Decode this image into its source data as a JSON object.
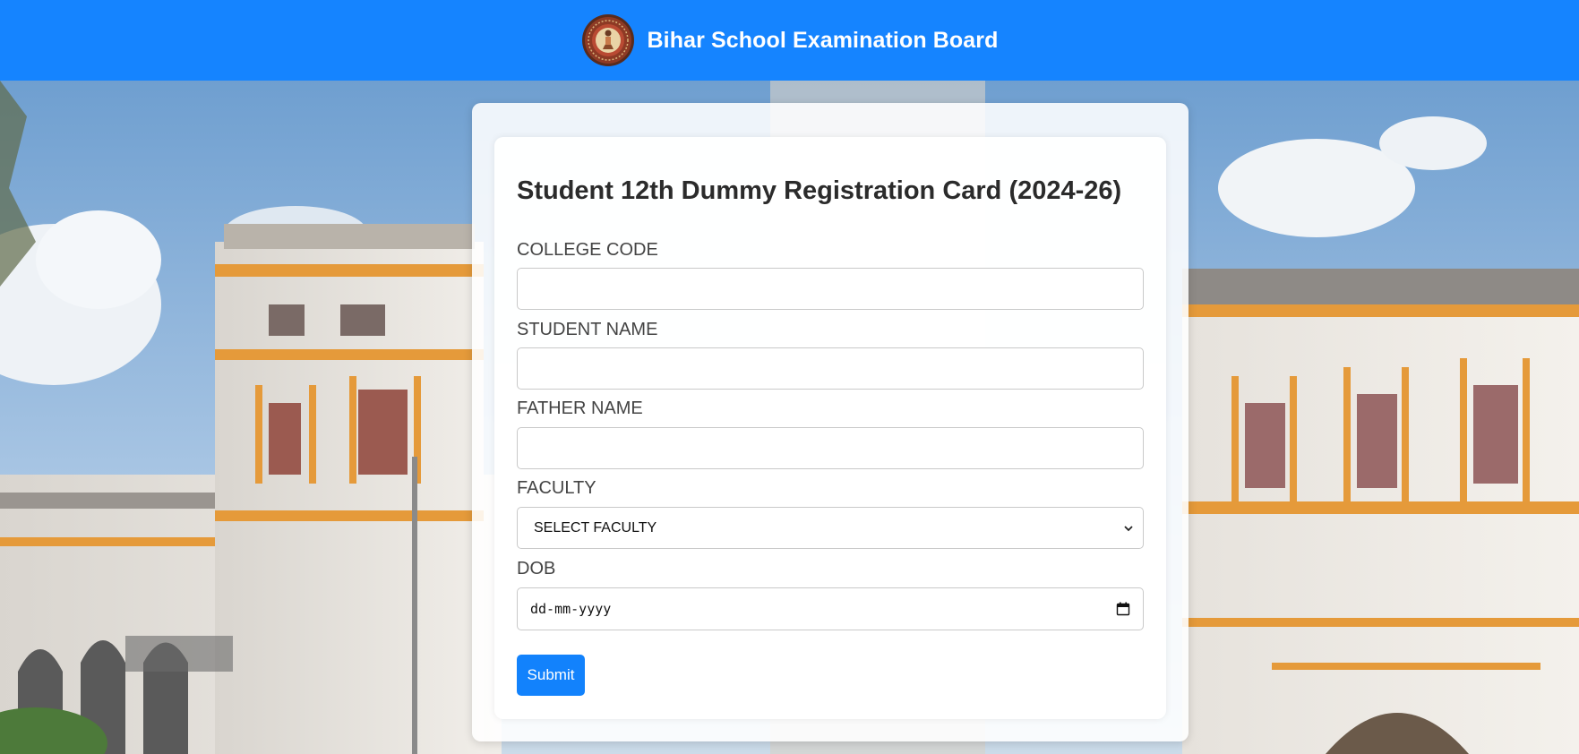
{
  "header": {
    "title": "Bihar School Examination Board",
    "logo_icon": "bseb-emblem-logo",
    "background_color": "#1584ff"
  },
  "background": {
    "description_icon": "heritage-building-photo"
  },
  "form": {
    "title": "Student 12th Dummy Registration Card (2024-26)",
    "fields": {
      "college_code": {
        "label": "COLLEGE CODE",
        "value": ""
      },
      "student_name": {
        "label": "STUDENT NAME",
        "value": ""
      },
      "father_name": {
        "label": "FATHER NAME",
        "value": ""
      },
      "faculty": {
        "label": "FACULTY",
        "selected": "SELECT FACULTY"
      },
      "dob": {
        "label": "DOB",
        "placeholder": "dd-mm-yyyy"
      }
    },
    "submit_label": "Submit",
    "accent_color": "#1282fc"
  }
}
